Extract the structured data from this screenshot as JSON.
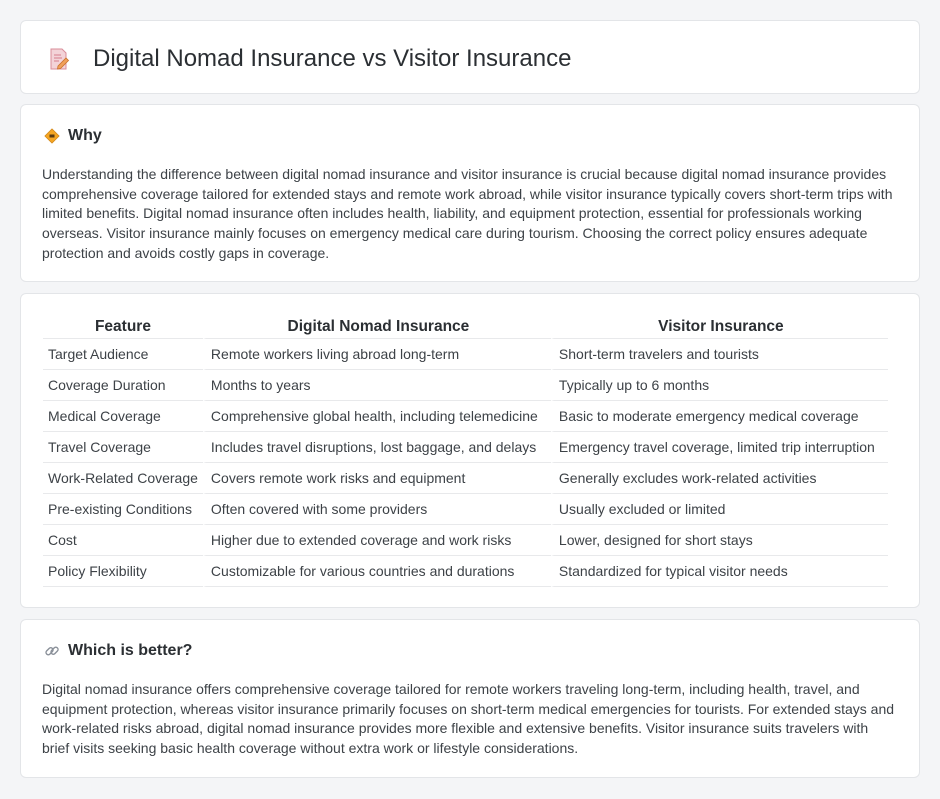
{
  "header": {
    "title": "Digital Nomad Insurance vs Visitor Insurance",
    "icon": "document-pencil-icon"
  },
  "why": {
    "heading": "Why",
    "icon": "diamond-warning-icon",
    "text": "Understanding the difference between digital nomad insurance and visitor insurance is crucial because digital nomad insurance provides comprehensive coverage tailored for extended stays and remote work abroad, while visitor insurance typically covers short-term trips with limited benefits. Digital nomad insurance often includes health, liability, and equipment protection, essential for professionals working overseas. Visitor insurance mainly focuses on emergency medical care during tourism. Choosing the correct policy ensures adequate protection and avoids costly gaps in coverage."
  },
  "table": {
    "headers": [
      "Feature",
      "Digital Nomad Insurance",
      "Visitor Insurance"
    ],
    "rows": [
      [
        "Target Audience",
        "Remote workers living abroad long-term",
        "Short-term travelers and tourists"
      ],
      [
        "Coverage Duration",
        "Months to years",
        "Typically up to 6 months"
      ],
      [
        "Medical Coverage",
        "Comprehensive global health, including telemedicine",
        "Basic to moderate emergency medical coverage"
      ],
      [
        "Travel Coverage",
        "Includes travel disruptions, lost baggage, and delays",
        "Emergency travel coverage, limited trip interruption"
      ],
      [
        "Work-Related Coverage",
        "Covers remote work risks and equipment",
        "Generally excludes work-related activities"
      ],
      [
        "Pre-existing Conditions",
        "Often covered with some providers",
        "Usually excluded or limited"
      ],
      [
        "Cost",
        "Higher due to extended coverage and work risks",
        "Lower, designed for short stays"
      ],
      [
        "Policy Flexibility",
        "Customizable for various countries and durations",
        "Standardized for typical visitor needs"
      ]
    ]
  },
  "better": {
    "heading": "Which is better?",
    "icon": "link-icon",
    "text": "Digital nomad insurance offers comprehensive coverage tailored for remote workers traveling long-term, including health, travel, and equipment protection, whereas visitor insurance primarily focuses on short-term medical emergencies for tourists. For extended stays and work-related risks abroad, digital nomad insurance provides more flexible and extensive benefits. Visitor insurance suits travelers with brief visits seeking basic health coverage without extra work or lifestyle considerations."
  }
}
